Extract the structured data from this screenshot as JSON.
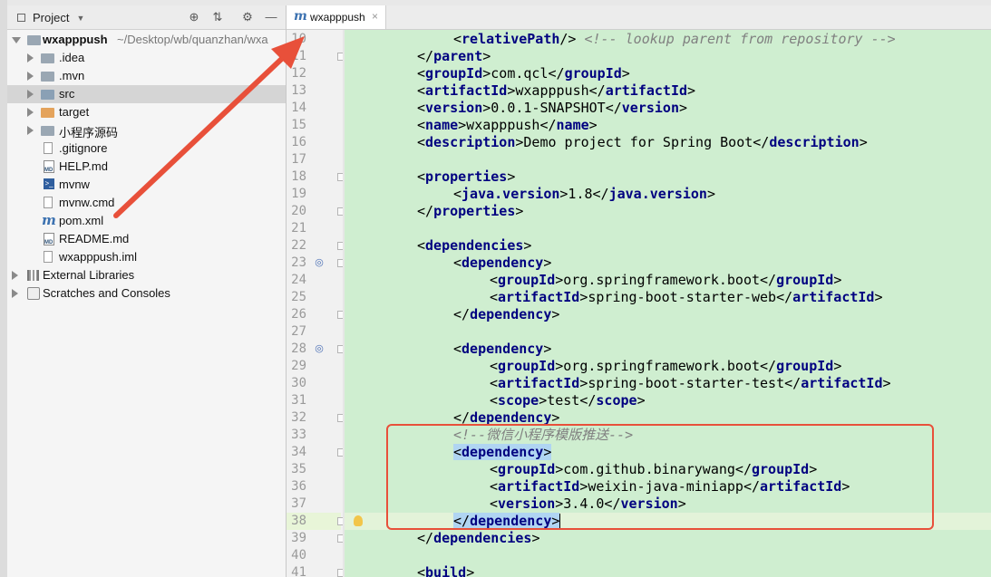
{
  "project_panel": {
    "title": "Project",
    "tree": [
      {
        "label": "wxapppush",
        "suffix": " ~/Desktop/wb/quanzhan/wxa",
        "icon": "module-folder-icon",
        "expanded": true,
        "bold": true
      },
      {
        "label": ".idea",
        "icon": "folder-icon"
      },
      {
        "label": ".mvn",
        "icon": "folder-icon"
      },
      {
        "label": "src",
        "icon": "folder-icon",
        "selected": true
      },
      {
        "label": "target",
        "icon": "excluded-folder-icon"
      },
      {
        "label": "小程序源码",
        "icon": "folder-icon"
      },
      {
        "label": ".gitignore",
        "icon": "file-icon"
      },
      {
        "label": "HELP.md",
        "icon": "markdown-file-icon"
      },
      {
        "label": "mvnw",
        "icon": "shell-script-icon"
      },
      {
        "label": "mvnw.cmd",
        "icon": "file-icon"
      },
      {
        "label": "pom.xml",
        "icon": "maven-icon"
      },
      {
        "label": "README.md",
        "icon": "markdown-file-icon"
      },
      {
        "label": "wxapppush.iml",
        "icon": "iml-file-icon"
      },
      {
        "label": "External Libraries",
        "icon": "library-icon"
      },
      {
        "label": "Scratches and Consoles",
        "icon": "scratches-icon"
      }
    ]
  },
  "editor": {
    "tab": {
      "label": "wxapppush",
      "icon_letter": "m",
      "close": "×"
    },
    "lines": [
      {
        "n": "10",
        "indent": 2,
        "text": "<relativePath/> <!-- lookup parent from repository -->"
      },
      {
        "n": "11",
        "indent": 1,
        "text": "</parent>"
      },
      {
        "n": "12",
        "indent": 1,
        "text": "<groupId>com.qcl</groupId>"
      },
      {
        "n": "13",
        "indent": 1,
        "text": "<artifactId>wxapppush</artifactId>"
      },
      {
        "n": "14",
        "indent": 1,
        "text": "<version>0.0.1-SNAPSHOT</version>"
      },
      {
        "n": "15",
        "indent": 1,
        "text": "<name>wxapppush</name>"
      },
      {
        "n": "16",
        "indent": 1,
        "text": "<description>Demo project for Spring Boot</description>"
      },
      {
        "n": "17",
        "indent": 0,
        "text": ""
      },
      {
        "n": "18",
        "indent": 1,
        "text": "<properties>"
      },
      {
        "n": "19",
        "indent": 2,
        "text": "<java.version>1.8</java.version>"
      },
      {
        "n": "20",
        "indent": 1,
        "text": "</properties>"
      },
      {
        "n": "21",
        "indent": 0,
        "text": ""
      },
      {
        "n": "22",
        "indent": 1,
        "text": "<dependencies>"
      },
      {
        "n": "23",
        "indent": 2,
        "text": "<dependency>"
      },
      {
        "n": "24",
        "indent": 3,
        "text": "<groupId>org.springframework.boot</groupId>"
      },
      {
        "n": "25",
        "indent": 3,
        "text": "<artifactId>spring-boot-starter-web</artifactId>"
      },
      {
        "n": "26",
        "indent": 2,
        "text": "</dependency>"
      },
      {
        "n": "27",
        "indent": 0,
        "text": ""
      },
      {
        "n": "28",
        "indent": 2,
        "text": "<dependency>"
      },
      {
        "n": "29",
        "indent": 3,
        "text": "<groupId>org.springframework.boot</groupId>"
      },
      {
        "n": "30",
        "indent": 3,
        "text": "<artifactId>spring-boot-starter-test</artifactId>"
      },
      {
        "n": "31",
        "indent": 3,
        "text": "<scope>test</scope>"
      },
      {
        "n": "32",
        "indent": 2,
        "text": "</dependency>"
      },
      {
        "n": "33",
        "indent": 2,
        "text": "<!--微信小程序模版推送-->"
      },
      {
        "n": "34",
        "indent": 2,
        "text": "<dependency>",
        "highlight": true
      },
      {
        "n": "35",
        "indent": 3,
        "text": "<groupId>com.github.binarywang</groupId>"
      },
      {
        "n": "36",
        "indent": 3,
        "text": "<artifactId>weixin-java-miniapp</artifactId>"
      },
      {
        "n": "37",
        "indent": 3,
        "text": "<version>3.4.0</version>"
      },
      {
        "n": "38",
        "indent": 2,
        "text": "</dependency>",
        "highlight": true,
        "current": true
      },
      {
        "n": "39",
        "indent": 1,
        "text": "</dependencies>"
      },
      {
        "n": "40",
        "indent": 0,
        "text": ""
      },
      {
        "n": "41",
        "indent": 1,
        "text": "<build>"
      }
    ]
  },
  "colors": {
    "tag": "#000080",
    "comment": "#808080",
    "code_background": "#cfeed0",
    "annotation": "#e8503a"
  }
}
